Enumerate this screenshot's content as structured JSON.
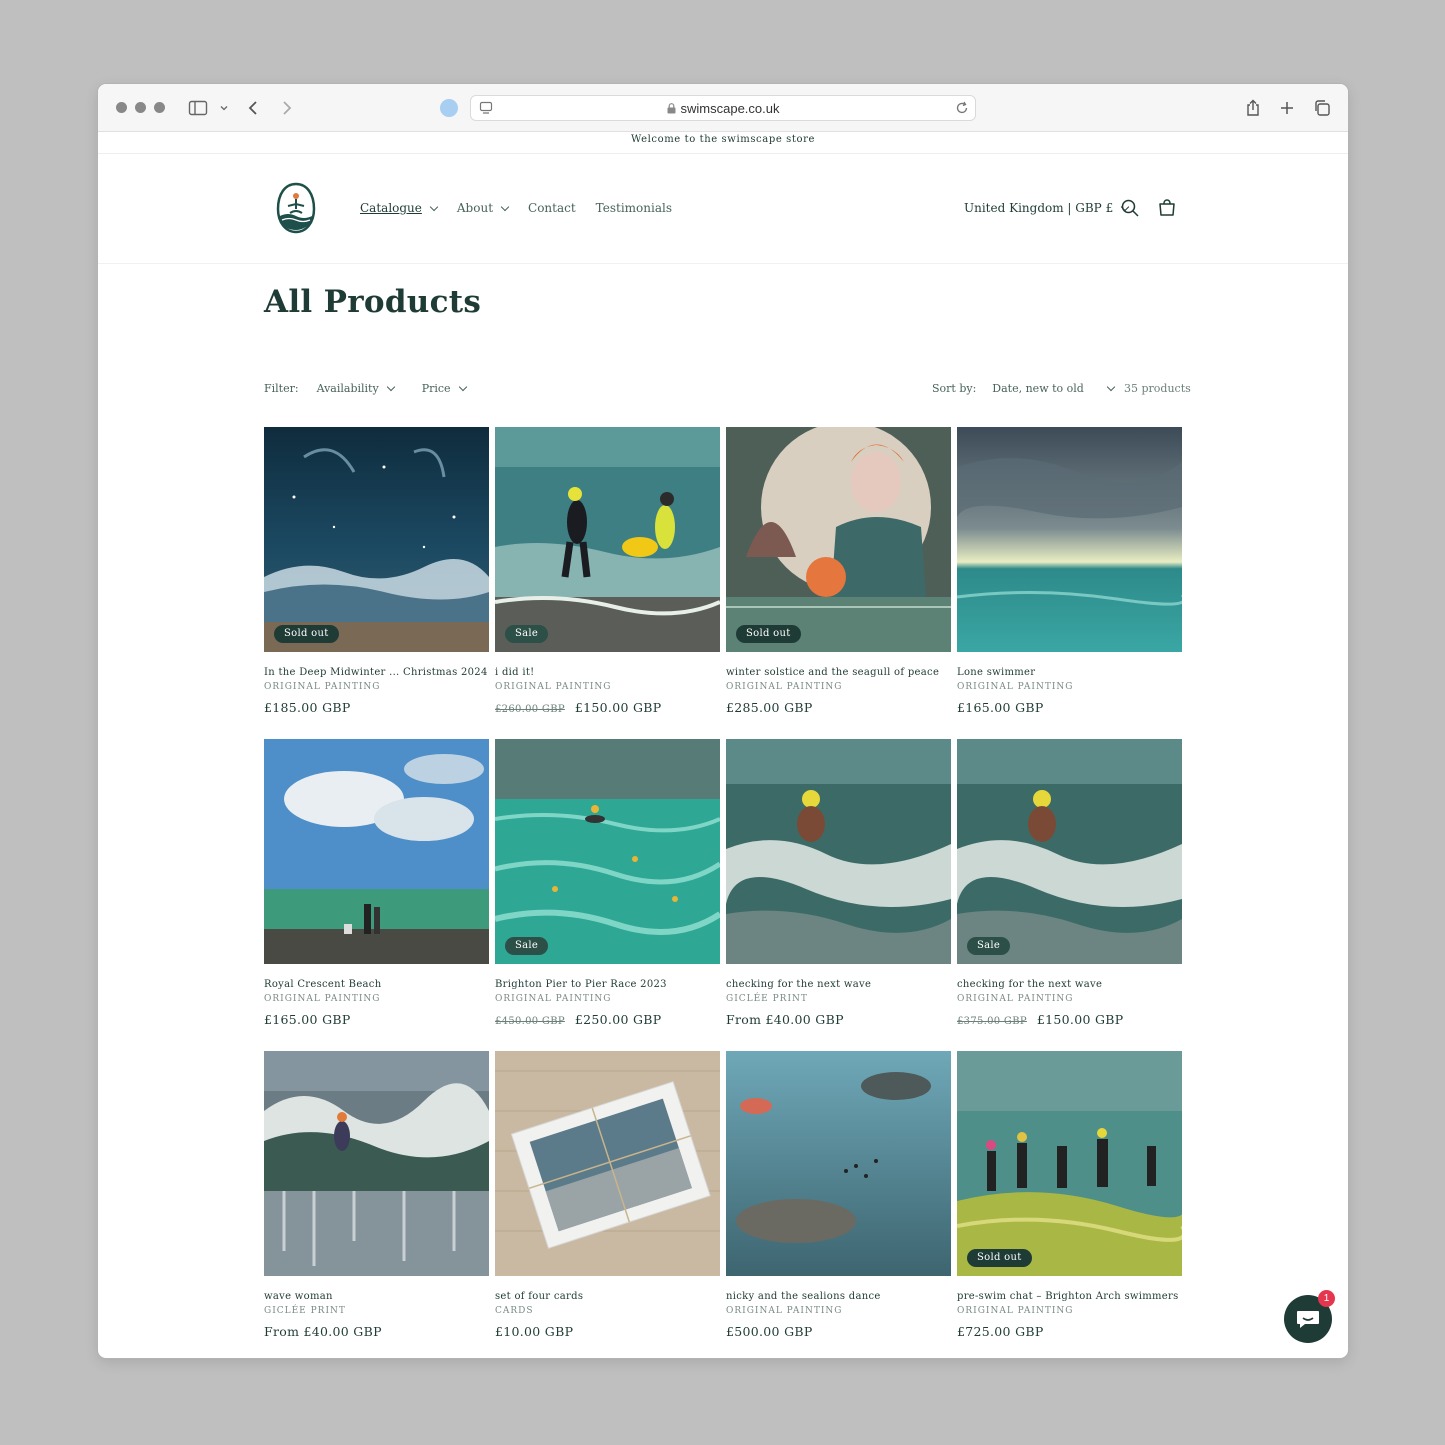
{
  "browser": {
    "url": "swimscape.co.uk"
  },
  "announcement": "Welcome to the swimscape store",
  "nav": {
    "catalogue": "Catalogue",
    "about": "About",
    "contact": "Contact",
    "testimonials": "Testimonials"
  },
  "localization": "United Kingdom | GBP £",
  "page_title": "All Products",
  "filters": {
    "label": "Filter:",
    "availability": "Availability",
    "price": "Price",
    "sort_label": "Sort by:",
    "sort_value": "Date, new to old",
    "count": "35 products"
  },
  "chat": {
    "unread": "1"
  },
  "products": [
    {
      "title": "In the Deep Midwinter ... Christmas 2024",
      "vendor": "ORIGINAL PAINTING",
      "old_price": "",
      "price": "£185.00 GBP",
      "badge": "Sold out"
    },
    {
      "title": "i did it!",
      "vendor": "ORIGINAL PAINTING",
      "old_price": "£260.00 GBP",
      "price": "£150.00 GBP",
      "badge": "Sale"
    },
    {
      "title": "winter solstice and the seagull of peace",
      "vendor": "ORIGINAL PAINTING",
      "old_price": "",
      "price": "£285.00 GBP",
      "badge": "Sold out"
    },
    {
      "title": "Lone swimmer",
      "vendor": "ORIGINAL PAINTING",
      "old_price": "",
      "price": "£165.00 GBP",
      "badge": ""
    },
    {
      "title": "Royal Crescent Beach",
      "vendor": "ORIGINAL PAINTING",
      "old_price": "",
      "price": "£165.00 GBP",
      "badge": ""
    },
    {
      "title": "Brighton Pier to Pier Race 2023",
      "vendor": "ORIGINAL PAINTING",
      "old_price": "£450.00 GBP",
      "price": "£250.00 GBP",
      "badge": "Sale"
    },
    {
      "title": "checking for the next wave",
      "vendor": "GICLÉE PRINT",
      "old_price": "",
      "price": "From £40.00 GBP",
      "badge": ""
    },
    {
      "title": "checking for the next wave",
      "vendor": "ORIGINAL PAINTING",
      "old_price": "£375.00 GBP",
      "price": "£150.00 GBP",
      "badge": "Sale"
    },
    {
      "title": "wave woman",
      "vendor": "GICLÉE PRINT",
      "old_price": "",
      "price": "From £40.00 GBP",
      "badge": ""
    },
    {
      "title": "set of four cards",
      "vendor": "CARDS",
      "old_price": "",
      "price": "£10.00 GBP",
      "badge": ""
    },
    {
      "title": "nicky and the sealions dance",
      "vendor": "ORIGINAL PAINTING",
      "old_price": "",
      "price": "£500.00 GBP",
      "badge": ""
    },
    {
      "title": "pre-swim chat – Brighton Arch swimmers",
      "vendor": "ORIGINAL PAINTING",
      "old_price": "",
      "price": "£725.00 GBP",
      "badge": "Sold out"
    }
  ]
}
